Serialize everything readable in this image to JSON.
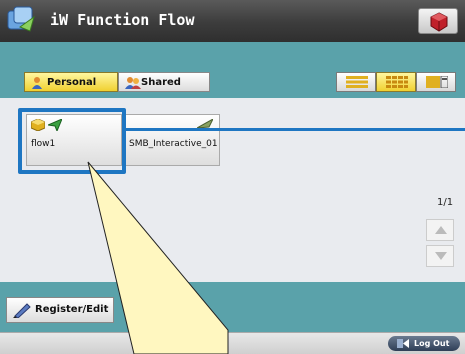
{
  "header": {
    "title": "iW Function Flow",
    "app_icon": "iw-function-flow-icon",
    "info_icon": "info-cube-icon"
  },
  "tabs": [
    {
      "label": "Personal",
      "icon": "person-icon",
      "selected": true
    },
    {
      "label": "Shared",
      "icon": "group-icon",
      "selected": false
    }
  ],
  "view_modes": [
    {
      "name": "list-view",
      "selected": false
    },
    {
      "name": "grid-view",
      "selected": true
    },
    {
      "name": "detail-view",
      "selected": false
    }
  ],
  "flows": [
    {
      "label": "flow1",
      "icons": [
        "box-icon",
        "paper-plane-icon"
      ],
      "selected": true
    },
    {
      "label": "SMB_Interactive_01",
      "icons": [
        "feather-icon"
      ],
      "selected": false
    }
  ],
  "pagination": {
    "text": "1/1"
  },
  "footer": {
    "register_label": "Register/Edit",
    "logout_label": "Log Out"
  },
  "colors": {
    "teal": "#5aa2aa",
    "selection": "#1e76c2",
    "tab_selected": "#f0d030",
    "callout_fill": "#fff7c0"
  }
}
